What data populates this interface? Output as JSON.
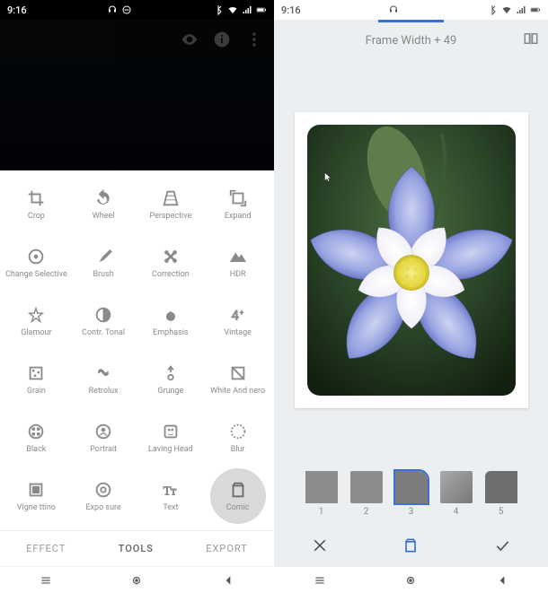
{
  "status_bar": {
    "left_time": "9:16",
    "right_time": "9:16"
  },
  "left": {
    "top_icons": [
      "eye-icon",
      "info-icon",
      "more-icon"
    ],
    "tools": [
      {
        "icon": "crop",
        "label": "Crop"
      },
      {
        "icon": "rotate",
        "label": "Wheel"
      },
      {
        "icon": "perspective",
        "label": "Perspective"
      },
      {
        "icon": "expand",
        "label": "Expand"
      },
      {
        "icon": "selective",
        "label": "Change Selective"
      },
      {
        "icon": "brush",
        "label": "Brush"
      },
      {
        "icon": "correction",
        "label": "Correction"
      },
      {
        "icon": "hdr",
        "label": "HDR"
      },
      {
        "icon": "glamour",
        "label": "Glamour"
      },
      {
        "icon": "tonal",
        "label": "Contr. Tonal"
      },
      {
        "icon": "emphasis",
        "label": "Emphasis"
      },
      {
        "icon": "vintage",
        "label": "Vintage"
      },
      {
        "icon": "grain",
        "label": "Grain"
      },
      {
        "icon": "retrolux",
        "label": "Retrolux"
      },
      {
        "icon": "grunge",
        "label": "Grunge"
      },
      {
        "icon": "bw",
        "label": "White And nero"
      },
      {
        "icon": "black",
        "label": "Black"
      },
      {
        "icon": "portrait",
        "label": "Portrait"
      },
      {
        "icon": "head",
        "label": "Laving Head"
      },
      {
        "icon": "blur",
        "label": "Blur"
      },
      {
        "icon": "vignette",
        "label": "Vigne ttino"
      },
      {
        "icon": "exposure",
        "label": "Expo sure"
      },
      {
        "icon": "text",
        "label": "Text"
      },
      {
        "icon": "comic",
        "label": "Comic"
      }
    ],
    "tabs": {
      "effect": "EFFECT",
      "tools": "TOOLS",
      "export": "EXPORT"
    }
  },
  "right": {
    "title": "Frame Width + 49",
    "thumbs": [
      "1",
      "2",
      "3",
      "4",
      "5"
    ],
    "selected_thumb": 3
  }
}
